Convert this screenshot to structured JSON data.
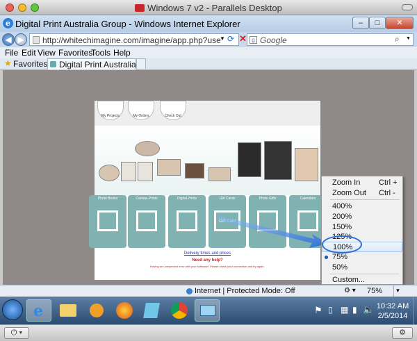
{
  "mac_window": {
    "title": "Windows 7 v2 - Parallels Desktop",
    "traffic_colors": [
      "#ee5f57",
      "#f7bc2e",
      "#5dc83e"
    ]
  },
  "ie": {
    "title": "Digital Print Australia Group - Windows Internet Explorer",
    "address": "http://whitechimagine.com/imagine/app.php?userGrou",
    "search_placeholder": "Google",
    "menu": [
      "File",
      "Edit",
      "View",
      "Favorites",
      "Tools",
      "Help"
    ],
    "favorites_label": "Favorites",
    "tab_title": "Digital Print Australia ...",
    "status_text": "Internet | Protected Mode: Off",
    "zoom_level": "75%",
    "icons": {
      "back": "back-arrow-icon",
      "forward": "forward-arrow-icon",
      "refresh": "refresh-icon",
      "stop": "stop-icon",
      "search": "search-icon",
      "favorites": "star-icon",
      "globe": "globe-icon"
    }
  },
  "site": {
    "buttons": [
      "My Projects",
      "My Orders",
      "Check Out"
    ],
    "categories": [
      "Photo Books",
      "Canvas Prints",
      "Digital Prints",
      "Gift Cards",
      "Photo Gifts",
      "Calendars"
    ],
    "gift_card_text": "Gift Card",
    "delivery_link": "Delivery times and prices",
    "help_line": "Need any help?",
    "footer_small": "Having an unexpected error with your software? Please check your connection and try again."
  },
  "zoom_menu": {
    "zoom_in": "Zoom In",
    "zoom_in_key": "Ctrl +",
    "zoom_out": "Zoom Out",
    "zoom_out_key": "Ctrl -",
    "levels": [
      "400%",
      "200%",
      "150%",
      "125%",
      "100%",
      "75%",
      "50%"
    ],
    "selected": "75%",
    "highlighted": "100%",
    "custom": "Custom...",
    "accent_color": "#2f6fd3"
  },
  "taskbar": {
    "time": "10:32 AM",
    "date": "2/5/2014",
    "apps": [
      "internet-explorer-icon",
      "folder-icon",
      "media-player-icon",
      "firefox-icon",
      "notepad-icon",
      "chrome-icon",
      "network-icon"
    ]
  }
}
